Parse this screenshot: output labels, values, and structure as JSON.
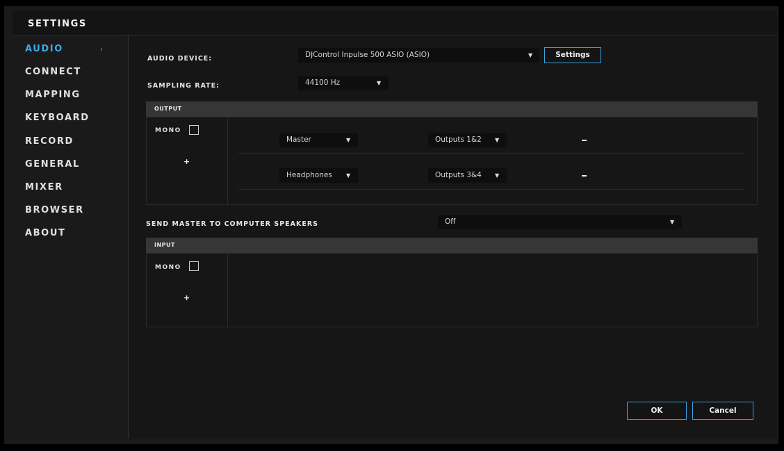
{
  "window": {
    "title": "SETTINGS"
  },
  "sidebar": {
    "items": [
      {
        "label": "AUDIO",
        "active": true
      },
      {
        "label": "CONNECT"
      },
      {
        "label": "MAPPING"
      },
      {
        "label": "KEYBOARD"
      },
      {
        "label": "RECORD"
      },
      {
        "label": "GENERAL"
      },
      {
        "label": "MIXER"
      },
      {
        "label": "BROWSER"
      },
      {
        "label": "ABOUT"
      }
    ],
    "active_arrow": "›"
  },
  "audio": {
    "device_label": "AUDIO DEVICE:",
    "device_value": "DJControl Inpulse 500 ASIO (ASIO)",
    "settings_button": "Settings",
    "sampling_label": "SAMPLING RATE:",
    "sampling_value": "44100 Hz",
    "output": {
      "header": "OUTPUT",
      "mono_label": "MONO",
      "plus": "+",
      "rows": [
        {
          "channel": "Master",
          "outputs": "Outputs 1&2"
        },
        {
          "channel": "Headphones",
          "outputs": "Outputs 3&4"
        }
      ]
    },
    "send_master_label": "SEND MASTER TO COMPUTER SPEAKERS",
    "send_master_value": "Off",
    "input": {
      "header": "INPUT",
      "mono_label": "MONO",
      "plus": "+"
    }
  },
  "footer": {
    "ok": "OK",
    "cancel": "Cancel"
  },
  "icons": {
    "dropdown": "▼"
  },
  "colors": {
    "accent": "#39a9e8",
    "background": "#161616",
    "header": "#363636"
  }
}
